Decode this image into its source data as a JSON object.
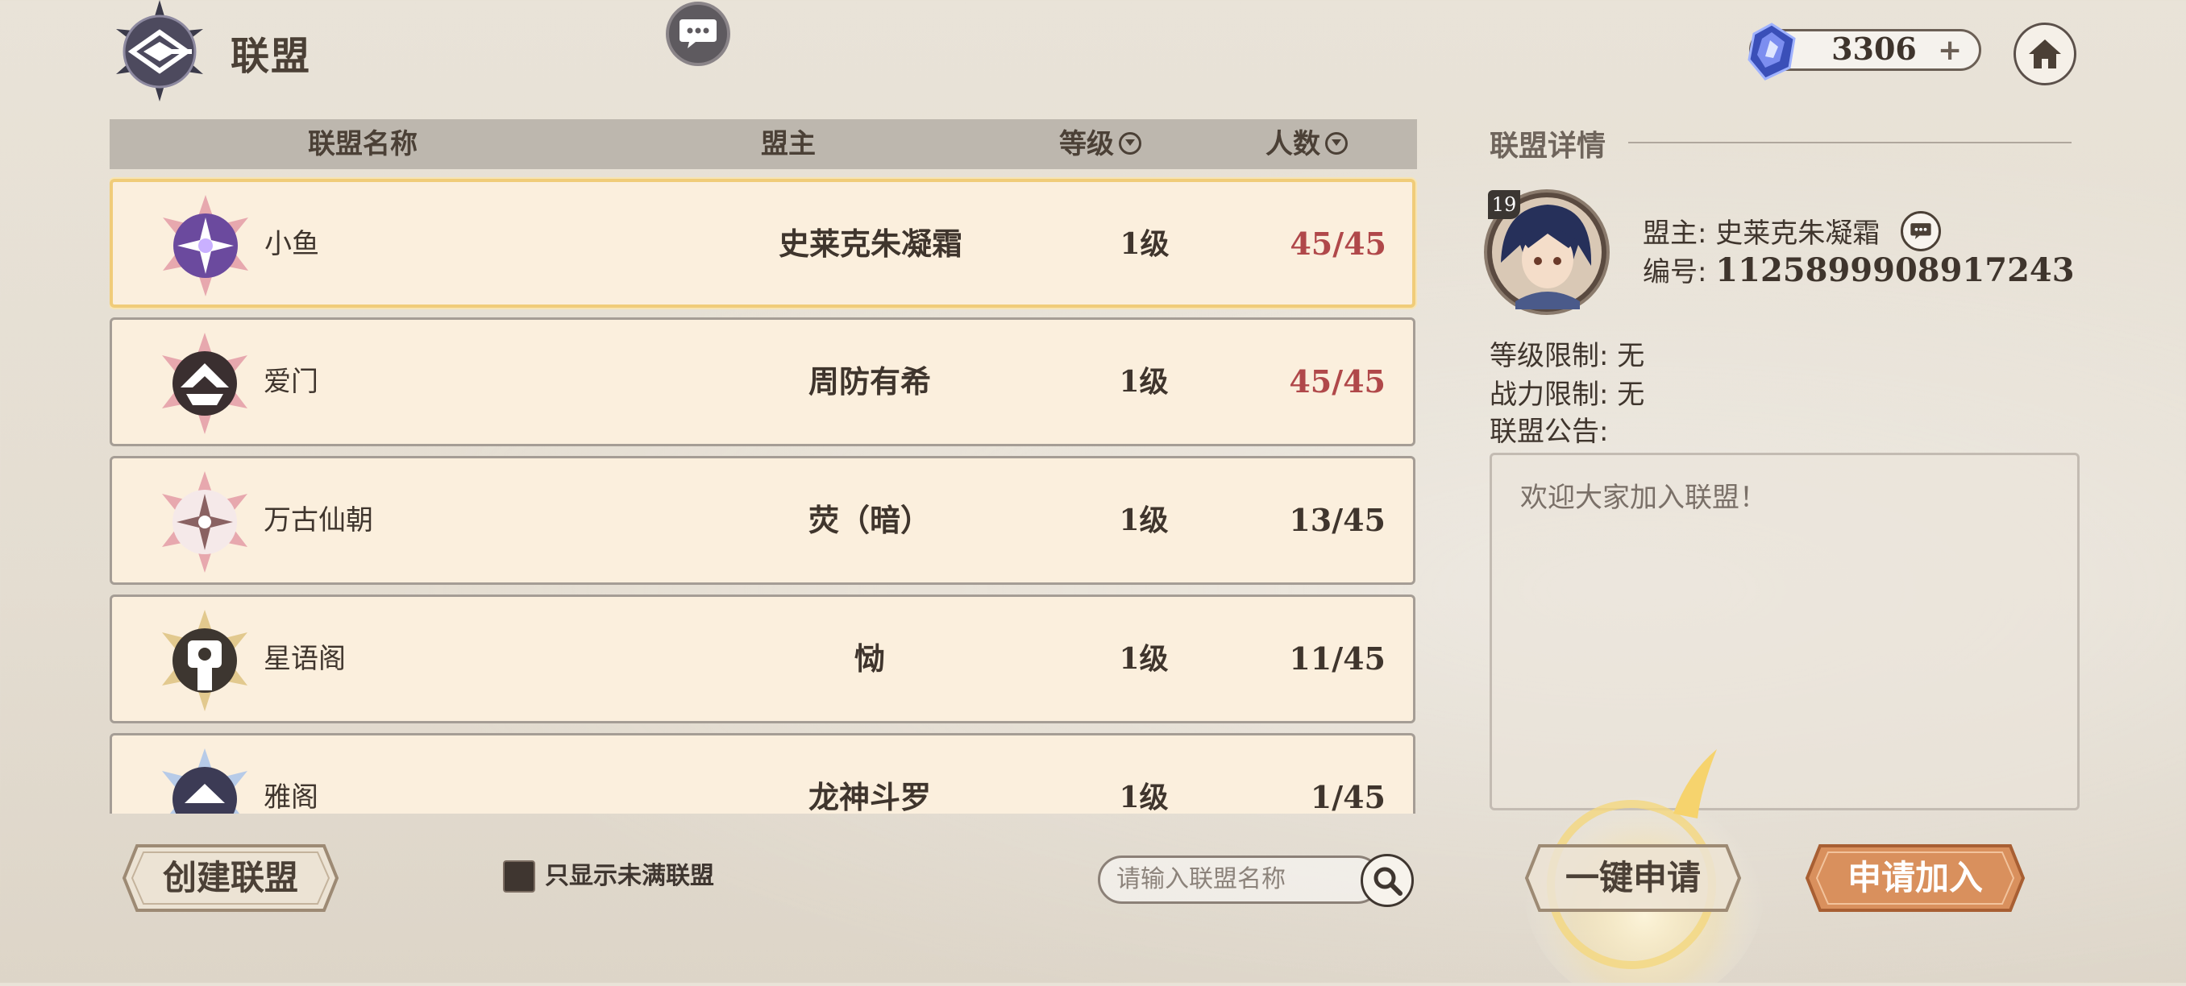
{
  "header": {
    "title": "联盟",
    "currency_value": "3306",
    "currency_plus": "+"
  },
  "list": {
    "columns": {
      "name": "联盟名称",
      "leader": "盟主",
      "level": "等级",
      "members": "人数"
    },
    "rows": [
      {
        "name": "小鱼",
        "leader": "史莱克朱凝霜",
        "level": "1级",
        "members": "45/45",
        "full": true,
        "selected": true,
        "emblem": "purple-flower-emblem"
      },
      {
        "name": "爱门",
        "leader": "周防有希",
        "level": "1级",
        "members": "45/45",
        "full": true,
        "selected": false,
        "emblem": "dark-crown-emblem"
      },
      {
        "name": "万古仙朝",
        "leader": "荧（暗）",
        "level": "1级",
        "members": "13/45",
        "full": false,
        "selected": false,
        "emblem": "white-flower-emblem"
      },
      {
        "name": "星语阁",
        "leader": "恸",
        "level": "1级",
        "members": "11/45",
        "full": false,
        "selected": false,
        "emblem": "gold-shield-emblem"
      },
      {
        "name": "雅阁",
        "leader": "龙神斗罗",
        "level": "1级",
        "members": "1/45",
        "full": false,
        "selected": false,
        "emblem": "blue-crest-emblem"
      }
    ]
  },
  "controls": {
    "create_label": "创建联盟",
    "filter_label": "只显示未满联盟",
    "search_placeholder": "请输入联盟名称"
  },
  "details": {
    "title": "联盟详情",
    "avatar_level": "19",
    "leader_label": "盟主:",
    "leader_name": "史莱克朱凝霜",
    "id_label": "编号:",
    "id_value": "1125899908917243",
    "level_limit_label": "等级限制:",
    "level_limit_value": "无",
    "power_limit_label": "战力限制:",
    "power_limit_value": "无",
    "notice_label": "联盟公告:",
    "notice_text": "欢迎大家加入联盟！",
    "onekey_label": "一键申请",
    "apply_label": "申请加入"
  },
  "colors": {
    "full_members": "#b0484a",
    "normal_members": "#3f352d",
    "row_bg": "#fbefdd",
    "selected_border": "#f0cc79",
    "apply_button": "#d9905d"
  }
}
